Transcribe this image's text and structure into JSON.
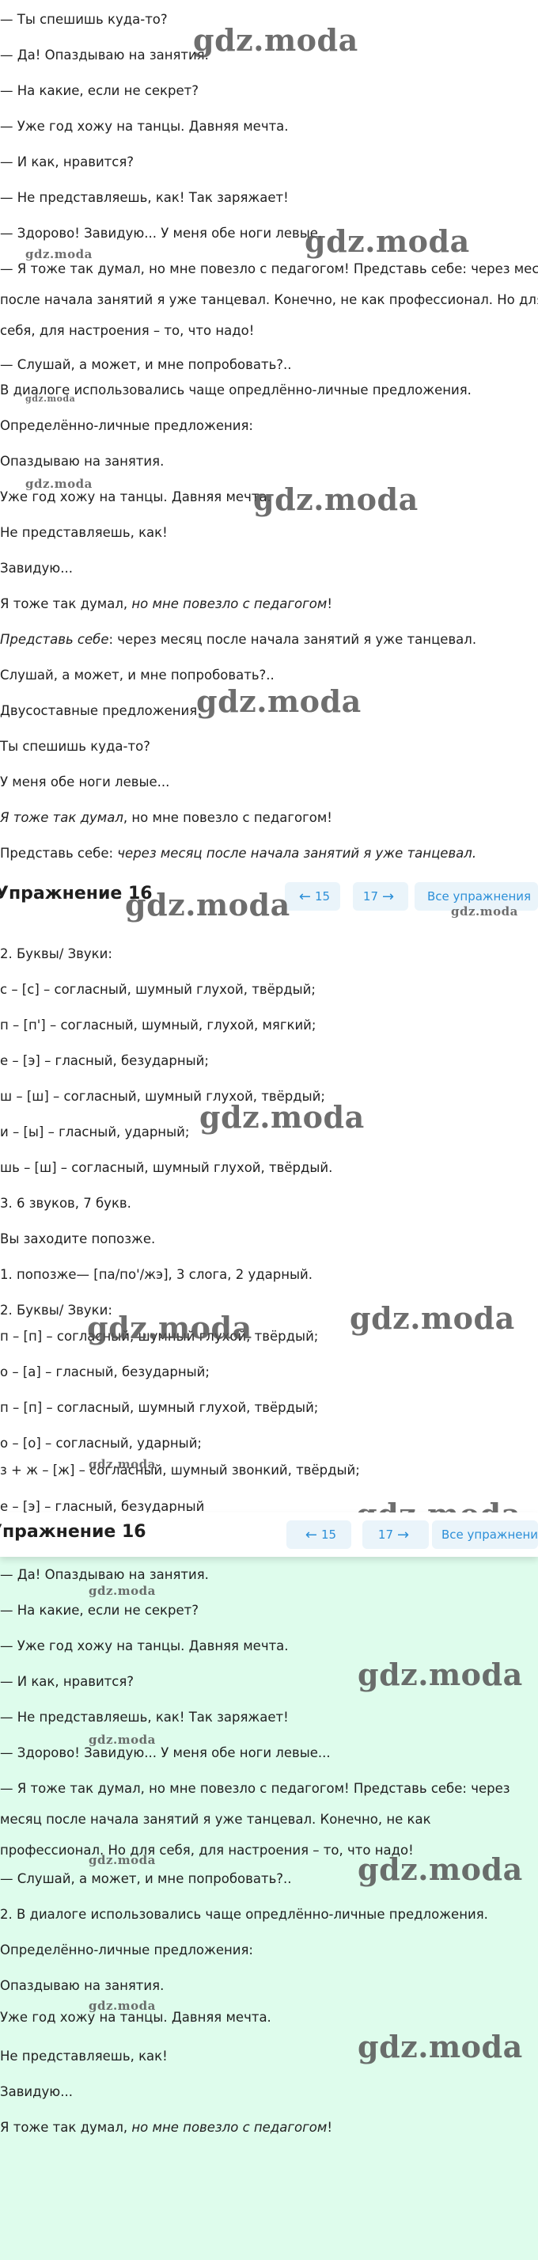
{
  "watermark": "gdz.moda",
  "nav": {
    "prev_label": "15",
    "next_label": "17",
    "all_label": "Все упражнения",
    "prev_icon": "arrow-left-icon",
    "next_icon": "arrow-right-icon"
  },
  "section1": {
    "lines": [
      "— Ты спешишь куда-то?",
      "— Да! Опаздываю на занятия.",
      "— На какие, если не секрет?",
      "— Уже год хожу на танцы. Давняя мечта.",
      "— И как, нравится?",
      "— Не представляешь, как! Так заряжает!",
      "— Здорово! Завидую... У меня обе ноги левые.",
      "— Я тоже так думал, но мне повезло с педагогом! Представь себе: через месяц",
      "после начала занятий я уже танцевал. Конечно, не как профессионал. Но для",
      "себя, для настроения – то, что надо!",
      "— Слушай, а может, и мне попробовать?..",
      "В диалоге использовались чаще опредлённо-личные предложения.",
      "Определённо-личные предложения:",
      "Опаздываю на занятия.",
      "Уже год хожу на танцы. Давняя мечта.",
      "Не представляешь, как!",
      "Завидую...",
      "Я тоже так думал, ",
      "но мне повезло с педагогом",
      "!",
      "Представь себе",
      ": через месяц после начала занятий я уже танцевал.",
      "Слушай, а может, и мне попробовать?..",
      "Двусоставные предложения:",
      "Ты спешишь куда-то?",
      "У меня обе ноги левые...",
      "Я тоже так думал",
      ", но мне повезло с педагогом!",
      "Представь себе: ",
      "через месяц после начала занятий я уже танцевал."
    ],
    "header_title": "Упражнение 16"
  },
  "section2": {
    "lines": [
      "2. Буквы/ Звуки:",
      "с – [с] – согласный, шумный глухой, твёрдый;",
      "п – [п'] – согласный, шумный, глухой, мягкий;",
      "е – [э] – гласный, безударный;",
      "ш – [ш] – согласный, шумный глухой, твёрдый;",
      "и – [ы] – гласный, ударный;",
      "шь – [ш] – согласный, шумный глухой, твёрдый.",
      "3. 6 звуков, 7 букв.",
      "Вы заходите попозже.",
      "1. попозже— [па/по'/жэ], 3 слога, 2 ударный.",
      "2. Буквы/ Звуки:",
      "п – [п] – согласный, шумный глухой, твёрдый;",
      "о – [а] – гласный, безударный;",
      "п – [п] – согласный, шумный глухой, твёрдый;",
      "о – [о] – согласный, ударный;",
      "з + ж – [ж] – согласный, шумный звонкий, твёрдый;",
      "е – [э] – гласный, безударный"
    ],
    "header_title": "Упражнение 16"
  },
  "section3": {
    "lines": [
      "— Да! Опаздываю на занятия.",
      "— На какие, если не секрет?",
      "— Уже год хожу на танцы. Давняя мечта.",
      "— И как, нравится?",
      "— Не представляешь, как! Так заряжает!",
      "— Здорово! Завидую... У меня обе ноги левые...",
      "— Я тоже так думал, но мне повезло с педагогом! Представь себе: через",
      "месяц после начала занятий я уже танцевал. Конечно, не как",
      "профессионал. Но для себя, для настроения – то, что надо!",
      "— Слушай, а может, и мне попробовать?..",
      "2. В диалоге использовались чаще опредлённо-личные предложения.",
      "Определённо-личные предложения:",
      "Опаздываю на занятия.",
      "Уже год хожу на танцы. Давняя мечта.",
      "Не представляешь, как!",
      "Завидую...",
      "Я тоже так думал, ",
      "но мне повезло с педагогом",
      "!"
    ]
  }
}
